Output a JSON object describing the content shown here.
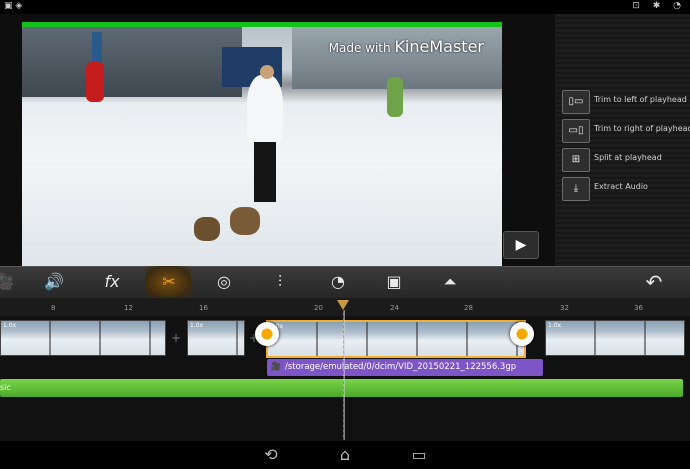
{
  "status_bar": {
    "left_icons": [
      "image-icon",
      "shield-icon"
    ],
    "right_icons": [
      "lock-icon",
      "bluetooth-icon",
      "wifi-icon"
    ]
  },
  "preview": {
    "watermark_prefix": "Made with",
    "watermark_brand": "KineMaster",
    "progress_fraction": 1.0,
    "play_icon": "▶"
  },
  "side_menu": [
    {
      "label": "Trim to left of playhead",
      "icon": "▯▭"
    },
    {
      "label": "Trim to right of playhead",
      "icon": "▭▯"
    },
    {
      "label": "Split at playhead",
      "icon": "⊞"
    },
    {
      "label": "Extract Audio",
      "icon": "⤓"
    }
  ],
  "toolbar": {
    "tools": [
      {
        "name": "camera-icon",
        "glyph": "🎥"
      },
      {
        "name": "volume-icon",
        "glyph": "🔊"
      },
      {
        "name": "fx-icon",
        "glyph": "fx"
      },
      {
        "name": "trim-scissors-icon",
        "glyph": "✂"
      },
      {
        "name": "color-filter-icon",
        "glyph": "◎"
      },
      {
        "name": "audio-mixer-icon",
        "glyph": "⫶"
      },
      {
        "name": "speed-gauge-icon",
        "glyph": "◔"
      },
      {
        "name": "crop-pan-icon",
        "glyph": "▣"
      },
      {
        "name": "audio-envelope-icon",
        "glyph": "⏶"
      }
    ],
    "undo_glyph": "↶"
  },
  "ruler": {
    "ticks": [
      "8",
      "12",
      "16",
      "20",
      "24",
      "28",
      "32",
      "36"
    ]
  },
  "timeline": {
    "clips": [
      {
        "speed": "1.0x"
      },
      {
        "speed": "1.0x"
      },
      {
        "speed": "1.0x"
      },
      {
        "speed": "1.0x"
      }
    ],
    "selected_clip_path": "/storage/emulated/0/dcim/VID_20150221_122556.3gp",
    "music_label": "sic"
  },
  "nav_bar": {
    "back": "⟲",
    "home": "⌂",
    "recents": "▭"
  }
}
